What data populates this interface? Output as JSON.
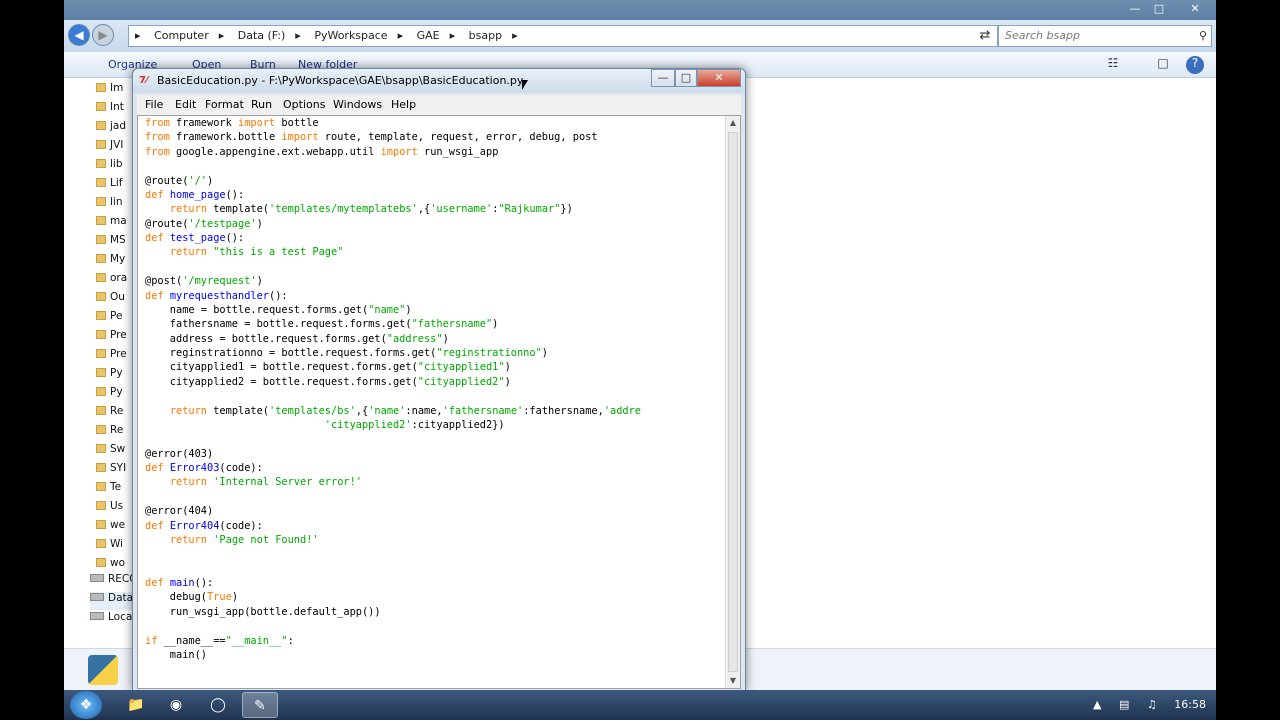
{
  "explorer": {
    "address": [
      "Computer",
      "Data (F:)",
      "PyWorkspace",
      "GAE",
      "bsapp"
    ],
    "search_placeholder": "Search bsapp",
    "commands": [
      "Organize",
      "Open",
      "Burn",
      "New folder"
    ],
    "nav_items": [
      "Im",
      "Int",
      "jad",
      "JVI",
      "lib",
      "Lif",
      "lin",
      "ma",
      "MS",
      "My",
      "ora",
      "Ou",
      "Pe",
      "Pre",
      "Pre",
      "Py",
      "Py",
      "Re",
      "Re",
      "Sw",
      "SYI",
      "Te",
      "Us",
      "we",
      "Wi",
      "wo"
    ],
    "drives": [
      "RECO",
      "Data",
      "Loca"
    ]
  },
  "idle": {
    "title": "BasicEducation.py - F:\\PyWorkspace\\GAE\\bsapp\\BasicEducation.py",
    "menu": [
      "File",
      "Edit",
      "Format",
      "Run",
      "Options",
      "Windows",
      "Help"
    ],
    "code_lines": [
      [
        [
          "from",
          "kw"
        ],
        [
          " framework ",
          ""
        ],
        [
          "import",
          "kw"
        ],
        [
          " bottle",
          ""
        ]
      ],
      [
        [
          "from",
          "kw"
        ],
        [
          " framework.bottle ",
          ""
        ],
        [
          "import",
          "kw"
        ],
        [
          " route, template, request, error, debug, post",
          ""
        ]
      ],
      [
        [
          "from",
          "kw"
        ],
        [
          " google.appengine.ext.webapp.util ",
          ""
        ],
        [
          "import",
          "kw"
        ],
        [
          " run_wsgi_app",
          ""
        ]
      ],
      [],
      [
        [
          "@route(",
          ""
        ],
        [
          "'/'",
          "st"
        ],
        [
          ")",
          ""
        ]
      ],
      [
        [
          "def",
          "kw"
        ],
        [
          " ",
          ""
        ],
        [
          "home_page",
          "fn"
        ],
        [
          "():",
          ""
        ]
      ],
      [
        [
          "    ",
          ""
        ],
        [
          "return",
          "kw"
        ],
        [
          " template(",
          ""
        ],
        [
          "'templates/mytemplatebs'",
          "st"
        ],
        [
          ",{",
          ""
        ],
        [
          "'username'",
          "st"
        ],
        [
          ":",
          ""
        ],
        [
          "\"Rajkumar\"",
          "st"
        ],
        [
          "})",
          ""
        ]
      ],
      [
        [
          "@route(",
          ""
        ],
        [
          "'/testpage'",
          "st"
        ],
        [
          ")",
          ""
        ]
      ],
      [
        [
          "def",
          "kw"
        ],
        [
          " ",
          ""
        ],
        [
          "test_page",
          "fn"
        ],
        [
          "():",
          ""
        ]
      ],
      [
        [
          "    ",
          ""
        ],
        [
          "return",
          "kw"
        ],
        [
          " ",
          ""
        ],
        [
          "\"this is a test Page\"",
          "st"
        ]
      ],
      [],
      [
        [
          "@post(",
          ""
        ],
        [
          "'/myrequest'",
          "st"
        ],
        [
          ")",
          ""
        ]
      ],
      [
        [
          "def",
          "kw"
        ],
        [
          " ",
          ""
        ],
        [
          "myrequesthandler",
          "fn"
        ],
        [
          "():",
          ""
        ]
      ],
      [
        [
          "    name = bottle.request.forms.get(",
          ""
        ],
        [
          "\"name\"",
          "st"
        ],
        [
          ")",
          ""
        ]
      ],
      [
        [
          "    fathersname = bottle.request.forms.get(",
          ""
        ],
        [
          "\"fathersname\"",
          "st"
        ],
        [
          ")",
          ""
        ]
      ],
      [
        [
          "    address = bottle.request.forms.get(",
          ""
        ],
        [
          "\"address\"",
          "st"
        ],
        [
          ")",
          ""
        ]
      ],
      [
        [
          "    reginstrationno = bottle.request.forms.get(",
          ""
        ],
        [
          "\"reginstrationno\"",
          "st"
        ],
        [
          ")",
          ""
        ]
      ],
      [
        [
          "    cityapplied1 = bottle.request.forms.get(",
          ""
        ],
        [
          "\"cityapplied1\"",
          "st"
        ],
        [
          ")",
          ""
        ]
      ],
      [
        [
          "    cityapplied2 = bottle.request.forms.get(",
          ""
        ],
        [
          "\"cityapplied2\"",
          "st"
        ],
        [
          ")",
          ""
        ]
      ],
      [],
      [
        [
          "    ",
          ""
        ],
        [
          "return",
          "kw"
        ],
        [
          " template(",
          ""
        ],
        [
          "'templates/bs'",
          "st"
        ],
        [
          ",{",
          ""
        ],
        [
          "'name'",
          "st"
        ],
        [
          ":name,",
          ""
        ],
        [
          "'fathersname'",
          "st"
        ],
        [
          ":fathersname,",
          ""
        ],
        [
          "'addre",
          "st"
        ]
      ],
      [
        [
          "                             ",
          ""
        ],
        [
          "'cityapplied2'",
          "st"
        ],
        [
          ":cityapplied2})",
          ""
        ]
      ],
      [],
      [
        [
          "@error(403)",
          ""
        ]
      ],
      [
        [
          "def",
          "kw"
        ],
        [
          " ",
          ""
        ],
        [
          "Error403",
          "fn"
        ],
        [
          "(code):",
          ""
        ]
      ],
      [
        [
          "    ",
          ""
        ],
        [
          "return",
          "kw"
        ],
        [
          " ",
          ""
        ],
        [
          "'Internal Server error!'",
          "st"
        ]
      ],
      [],
      [
        [
          "@error(404)",
          ""
        ]
      ],
      [
        [
          "def",
          "kw"
        ],
        [
          " ",
          ""
        ],
        [
          "Error404",
          "fn"
        ],
        [
          "(code):",
          ""
        ]
      ],
      [
        [
          "    ",
          ""
        ],
        [
          "return",
          "kw"
        ],
        [
          " ",
          ""
        ],
        [
          "'Page not Found!'",
          "st"
        ]
      ],
      [],
      [],
      [
        [
          "def",
          "kw"
        ],
        [
          " ",
          ""
        ],
        [
          "main",
          "fn"
        ],
        [
          "():",
          ""
        ]
      ],
      [
        [
          "    debug(",
          ""
        ],
        [
          "True",
          "kw"
        ],
        [
          ")",
          ""
        ]
      ],
      [
        [
          "    run_wsgi_app(bottle.default_app())",
          ""
        ]
      ],
      [],
      [
        [
          "if",
          "kw"
        ],
        [
          " __name__==",
          ""
        ],
        [
          "\"__main__\"",
          "st"
        ],
        [
          ":",
          ""
        ]
      ],
      [
        [
          "    main()",
          ""
        ]
      ]
    ]
  },
  "taskbar": {
    "time": "16:58"
  }
}
